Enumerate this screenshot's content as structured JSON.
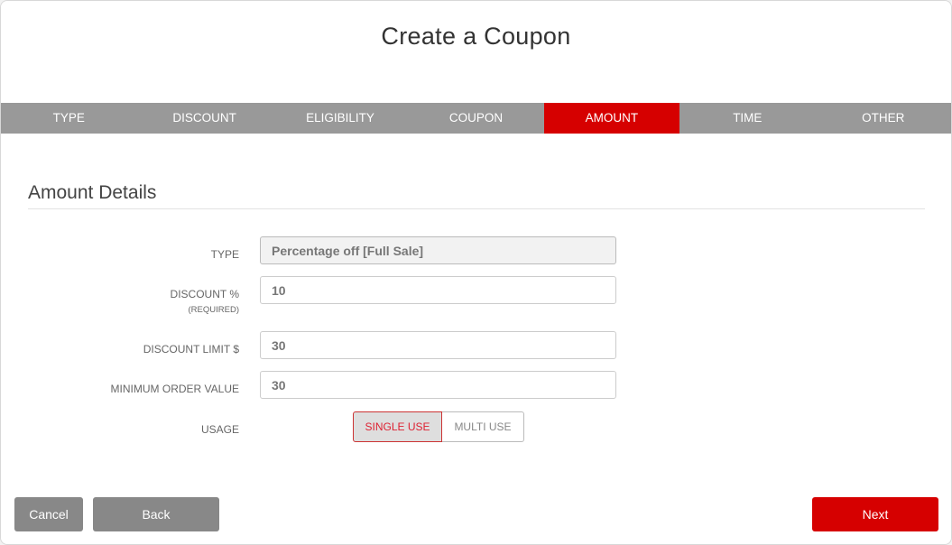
{
  "header": {
    "title": "Create a Coupon"
  },
  "steps": [
    {
      "label": "TYPE",
      "active": false
    },
    {
      "label": "DISCOUNT",
      "active": false
    },
    {
      "label": "ELIGIBILITY",
      "active": false
    },
    {
      "label": "COUPON",
      "active": false
    },
    {
      "label": "AMOUNT",
      "active": true
    },
    {
      "label": "TIME",
      "active": false
    },
    {
      "label": "OTHER",
      "active": false
    }
  ],
  "section": {
    "title": "Amount Details"
  },
  "form": {
    "type": {
      "label": "TYPE",
      "value": "Percentage off [Full Sale]"
    },
    "discount_pct": {
      "label": "DISCOUNT %",
      "sublabel": "(REQUIRED)",
      "value": "10"
    },
    "discount_limit": {
      "label": "DISCOUNT LIMIT $",
      "value": "30"
    },
    "min_order": {
      "label": "MINIMUM ORDER VALUE",
      "value": "30"
    },
    "usage": {
      "label": "USAGE",
      "options": [
        "SINGLE USE",
        "MULTI USE"
      ],
      "selected": "SINGLE USE"
    }
  },
  "footer": {
    "cancel_label": "Cancel",
    "back_label": "Back",
    "next_label": "Next"
  },
  "colors": {
    "accent": "#d60000",
    "step_bar": "#999999",
    "secondary_button": "#888888"
  }
}
